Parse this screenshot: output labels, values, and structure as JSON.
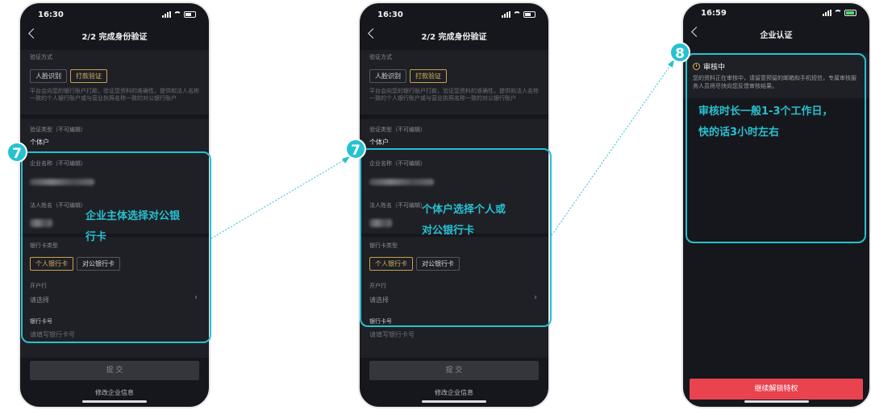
{
  "screen1": {
    "time": "16:30",
    "title": "2/2 完成身份验证",
    "verify_method_label": "验证方式",
    "method_options": [
      "人脸识别",
      "打款验证"
    ],
    "method_desc": "平台会向您的银行账户打款，验证您资料的准确性，提供和法人名称一致的个人银行账户或与营业执照名称一致的对公银行账户",
    "verify_type_label": "验证类型（不可编辑）",
    "verify_type_value": "个体户",
    "company_name_label": "企业名称（不可编辑）",
    "legal_name_label": "法人姓名（不可编辑）",
    "card_type_label": "银行卡类型",
    "card_options": [
      "个人银行卡",
      "对公银行卡"
    ],
    "bank_label": "开户行",
    "bank_placeholder": "请选择",
    "card_no_label": "银行卡号",
    "card_no_placeholder": "请填写银行卡号",
    "submit_label": "提 交",
    "modify_label": "修改企业信息",
    "step_number": "7",
    "callout_line1": "企业主体选择对公银",
    "callout_line2": "行卡"
  },
  "screen2": {
    "time": "16:30",
    "title": "2/2 完成身份验证",
    "verify_method_label": "验证方式",
    "method_options": [
      "人脸识别",
      "打款验证"
    ],
    "method_desc": "平台会向您的银行账户打款，验证您资料的准确性，提供和法人名称一致的个人银行账户或与营业执照名称一致的对公银行账户",
    "verify_type_label": "验证类型（不可编辑）",
    "verify_type_value": "个体户",
    "company_name_label": "企业名称（不可编辑）",
    "legal_name_label": "法人姓名（不可编辑）",
    "card_type_label": "银行卡类型",
    "card_options": [
      "个人银行卡",
      "对公银行卡"
    ],
    "bank_label": "开户行",
    "bank_placeholder": "请选择",
    "card_no_label": "银行卡号",
    "card_no_placeholder": "请填写银行卡号",
    "submit_label": "提 交",
    "modify_label": "修改企业信息",
    "step_number": "7",
    "callout_line1": "个体户选择个人或",
    "callout_line2": "对公银行卡"
  },
  "screen3": {
    "time": "16:59",
    "title": "企业认证",
    "review_title": "审核中",
    "review_text": "您的资料正在审核中，请留意预留的邮箱和手机短信，专属审核服务人员将尽快向您反馈审核结果。",
    "step_number": "8",
    "callout_line1": "审核时长一般1-3个工作日，",
    "callout_line2": "快的话3小时左右",
    "unlock_label": "继续解锁特权"
  },
  "colors": {
    "accent": "#27c1d1",
    "gold": "#c9a24a",
    "red_button": "#e8434f",
    "phone_bg": "#16171c"
  }
}
